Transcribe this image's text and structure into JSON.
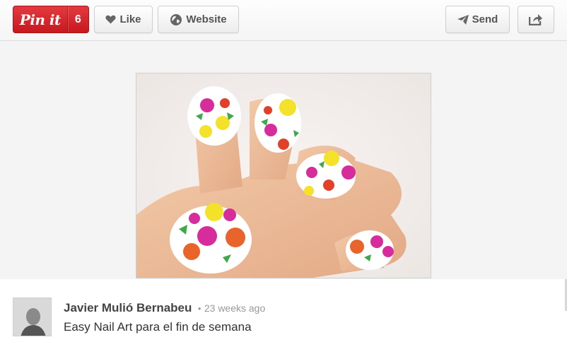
{
  "toolbar": {
    "pin_label": "Pin it",
    "pin_count": "6",
    "like_label": "Like",
    "website_label": "Website",
    "send_label": "Send",
    "icons": {
      "like": "heart-icon",
      "website": "globe-icon",
      "send": "paper-plane-icon",
      "share": "share-arrow-icon"
    }
  },
  "pin": {
    "image_description_icon": "nail-art-photo"
  },
  "author": {
    "name": "Javier Mulió Bernabeu",
    "separator": "•",
    "time": "23 weeks ago",
    "description": "Easy Nail Art para el fin de semana"
  },
  "colors": {
    "pin_red": "#cb2027",
    "background": "#f4f4f4"
  }
}
